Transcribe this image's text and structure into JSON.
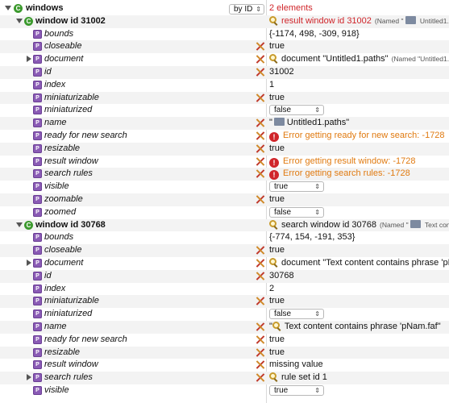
{
  "root": {
    "label": "windows",
    "sort_label": "by ID",
    "value": "2 elements"
  },
  "windows": [
    {
      "label": "window id 31002",
      "summary_text": "result window id 31002",
      "summary_note": "(Named \"",
      "summary_note2": " Untitled1.pa",
      "props": [
        {
          "name": "bounds",
          "x": false,
          "kind": "text",
          "value": "{-1174, 498, -309, 918}"
        },
        {
          "name": "closeable",
          "x": true,
          "kind": "text",
          "value": "true"
        },
        {
          "name": "document",
          "x": true,
          "kind": "ref",
          "expand": true,
          "value": "document \"Untitled1.paths\"",
          "note": "(Named \"Untitled1."
        },
        {
          "name": "id",
          "x": true,
          "kind": "text",
          "value": "31002"
        },
        {
          "name": "index",
          "x": false,
          "kind": "text",
          "value": "1"
        },
        {
          "name": "miniaturizable",
          "x": true,
          "kind": "text",
          "value": "true"
        },
        {
          "name": "miniaturized",
          "x": false,
          "kind": "select",
          "value": "false"
        },
        {
          "name": "name",
          "x": true,
          "kind": "name",
          "value": "Untitled1.paths\""
        },
        {
          "name": "ready for new search",
          "x": true,
          "kind": "error",
          "value": "Error getting ready for new search: -1728"
        },
        {
          "name": "resizable",
          "x": true,
          "kind": "text",
          "value": "true"
        },
        {
          "name": "result window",
          "x": true,
          "kind": "error",
          "value": "Error getting result window: -1728"
        },
        {
          "name": "search rules",
          "x": true,
          "kind": "error",
          "value": "Error getting search rules: -1728"
        },
        {
          "name": "visible",
          "x": false,
          "kind": "select",
          "value": "true"
        },
        {
          "name": "zoomable",
          "x": true,
          "kind": "text",
          "value": "true"
        },
        {
          "name": "zoomed",
          "x": false,
          "kind": "select",
          "value": "false"
        }
      ]
    },
    {
      "label": "window id 30768",
      "summary_text": "search window id 30768",
      "summary_note": "(Named \"",
      "summary_note2": " Text conte",
      "props": [
        {
          "name": "bounds",
          "x": false,
          "kind": "text",
          "value": "{-774, 154, -191, 353}"
        },
        {
          "name": "closeable",
          "x": true,
          "kind": "text",
          "value": "true"
        },
        {
          "name": "document",
          "x": true,
          "kind": "ref",
          "expand": true,
          "value": "document \"Text content contains phrase 'pN",
          "note": ""
        },
        {
          "name": "id",
          "x": true,
          "kind": "text",
          "value": "30768"
        },
        {
          "name": "index",
          "x": false,
          "kind": "text",
          "value": "2"
        },
        {
          "name": "miniaturizable",
          "x": true,
          "kind": "text",
          "value": "true"
        },
        {
          "name": "miniaturized",
          "x": false,
          "kind": "select",
          "value": "false"
        },
        {
          "name": "name",
          "x": true,
          "kind": "name2",
          "value": "Text content contains phrase 'pNam.faf\""
        },
        {
          "name": "ready for new search",
          "x": true,
          "kind": "text",
          "value": "true"
        },
        {
          "name": "resizable",
          "x": true,
          "kind": "text",
          "value": "true"
        },
        {
          "name": "result window",
          "x": true,
          "kind": "text",
          "value": "missing value"
        },
        {
          "name": "search rules",
          "x": true,
          "kind": "ref",
          "expand": true,
          "value": "rule set id 1",
          "note": ""
        },
        {
          "name": "visible",
          "x": false,
          "kind": "select",
          "value": "true"
        }
      ]
    }
  ],
  "colors": {
    "error": "#d0252a",
    "warning": "#e07a10",
    "class_icon": "#3c9a2e",
    "property_icon": "#8a5bb5"
  }
}
